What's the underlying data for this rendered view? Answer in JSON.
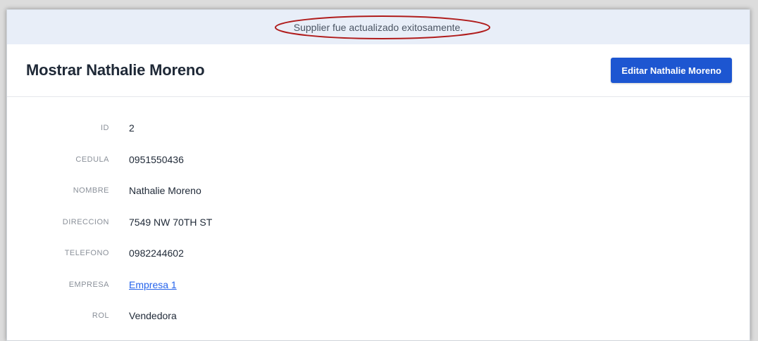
{
  "flash": {
    "message": "Supplier fue actualizado exitosamente."
  },
  "header": {
    "title": "Mostrar Nathalie Moreno",
    "edit_button": "Editar Nathalie Moreno"
  },
  "fields": [
    {
      "label": "ID",
      "value": "2"
    },
    {
      "label": "CEDULA",
      "value": "0951550436"
    },
    {
      "label": "NOMBRE",
      "value": "Nathalie Moreno"
    },
    {
      "label": "DIRECCION",
      "value": "7549 NW 70TH ST"
    },
    {
      "label": "TELEFONO",
      "value": "0982244602"
    },
    {
      "label": "EMPRESA",
      "value": "Empresa 1"
    },
    {
      "label": "ROL",
      "value": "Vendedora"
    }
  ],
  "colors": {
    "accent": "#1d56d1",
    "link": "#2563eb",
    "flash_bg": "#e8eef8",
    "annotation": "#b01c1c"
  }
}
